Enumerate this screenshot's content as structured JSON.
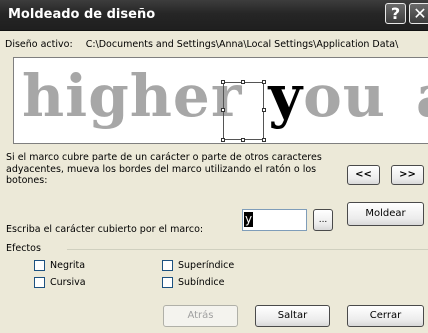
{
  "window": {
    "title": "Moldeado de diseño",
    "help_label": "?",
    "close_label": "✕"
  },
  "active_design": {
    "label": "Diseño activo:",
    "path": "C:\\Documents and Settings\\Anna\\Local Settings\\Application Data\\"
  },
  "preview": {
    "words": [
      "higher",
      "you",
      "ar"
    ],
    "highlighted_char": "y"
  },
  "instructions": "Si el marco cubre parte de un carácter o parte de otros caracteres adyacentes, mueva los bordes del marco utilizando el ratón o los botones:",
  "nav": {
    "prev_label": "<<",
    "next_label": ">>"
  },
  "char_field": {
    "label": "Escriba el carácter cubierto por el marco:",
    "value": "y",
    "browse_label": "..."
  },
  "moldear_label": "Moldear",
  "effects": {
    "legend": "Efectos",
    "negrita": {
      "label": "Negrita",
      "checked": false
    },
    "cursiva": {
      "label": "Cursiva",
      "checked": false
    },
    "superindice": {
      "label": "Superíndice",
      "checked": false
    },
    "subindice": {
      "label": "Subíndice",
      "checked": false
    }
  },
  "footer": {
    "atras_label": "Atrás",
    "saltar_label": "Saltar",
    "cerrar_label": "Cerrar"
  }
}
